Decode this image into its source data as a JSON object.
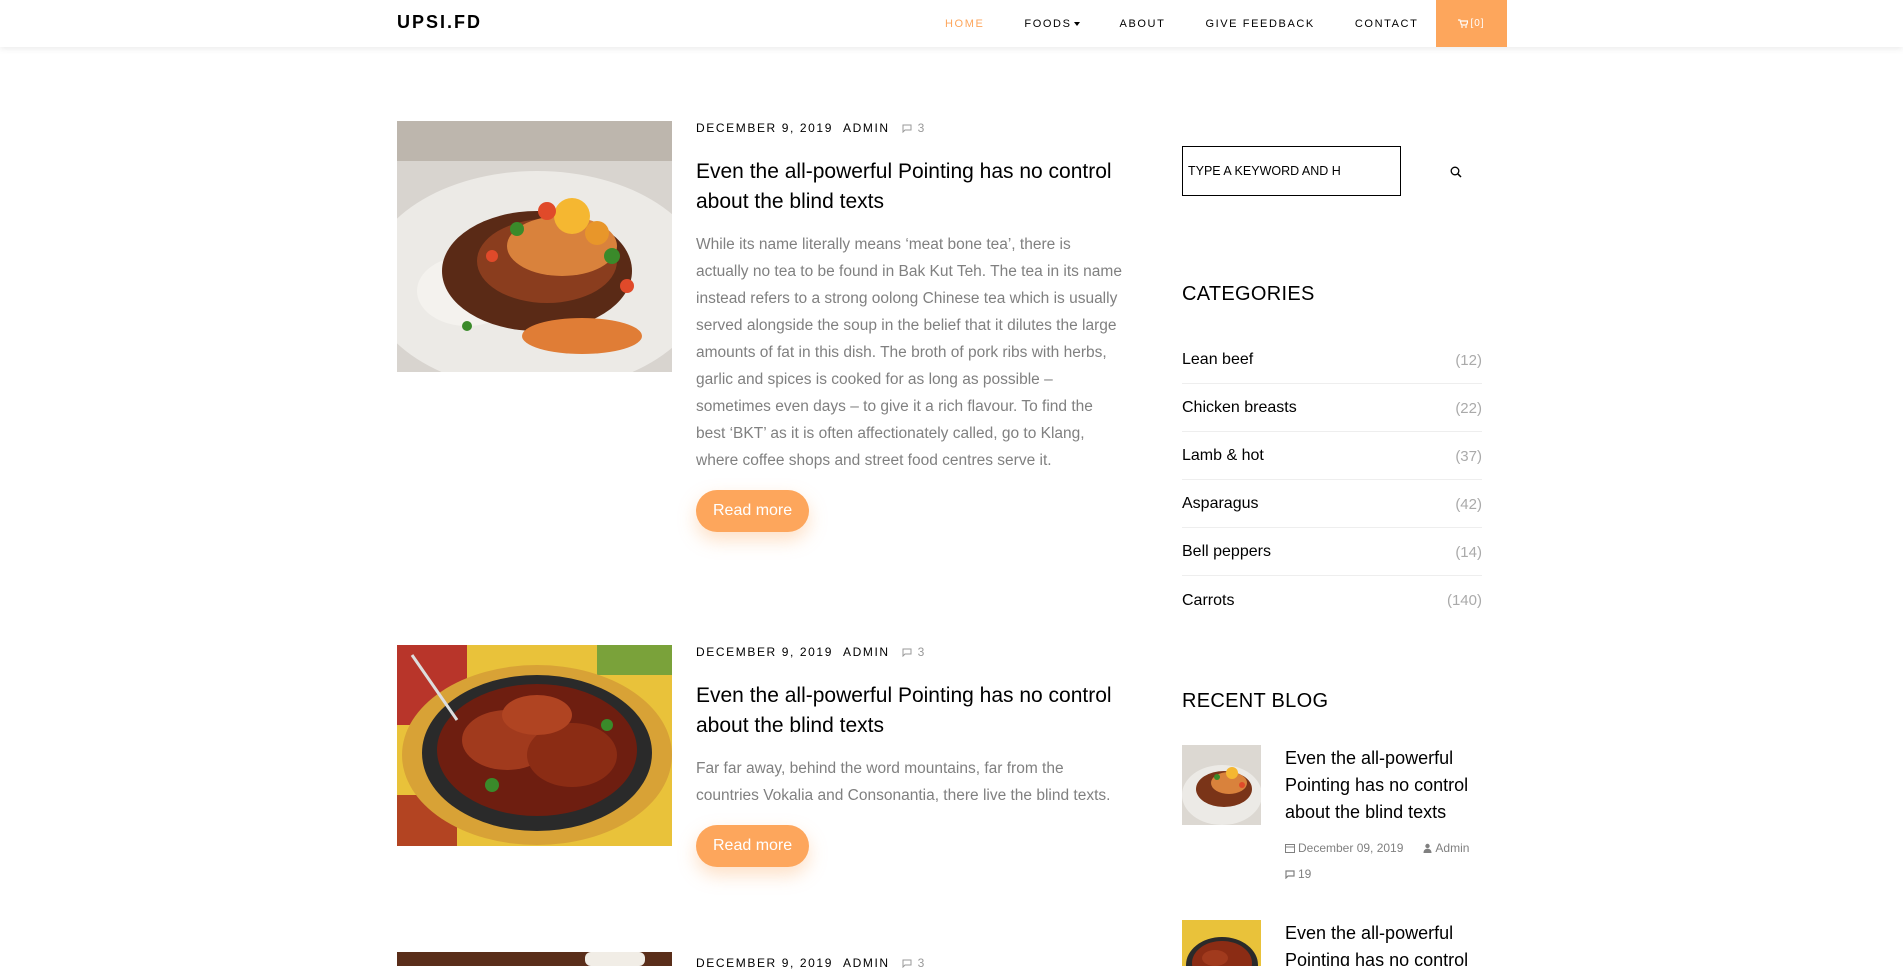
{
  "nav": {
    "brand": "UPSI.FD",
    "items": [
      {
        "label": "HOME",
        "active": true
      },
      {
        "label": "FOODS",
        "dropdown": true
      },
      {
        "label": "ABOUT"
      },
      {
        "label": "GIVE FEEDBACK"
      },
      {
        "label": "CONTACT"
      }
    ],
    "cart_label": "[0]",
    "cart_icon": "cart-icon",
    "accent_color": "#fda65c"
  },
  "posts": [
    {
      "date": "DECEMBER 9, 2019",
      "author": "ADMIN",
      "comments": "3",
      "title": "Even the all-powerful Pointing has no control about the blind texts",
      "excerpt": "While its name literally means ‘meat bone tea’, there is actually no tea to be found in Bak Kut Teh. The tea in its name instead refers to a strong oolong Chinese tea which is usually served alongside the soup in the belief that it dilutes the large amounts of fat in this dish. The broth of pork ribs with herbs, garlic and spices is cooked for as long as possible – sometimes even days – to give it a rich flavour. To find the best ‘BKT’ as it is often affectionately called, go to Klang, where coffee shops and street food centres serve it.",
      "read_more": "Read more"
    },
    {
      "date": "DECEMBER 9, 2019",
      "author": "ADMIN",
      "comments": "3",
      "title": "Even the all-powerful Pointing has no control about the blind texts",
      "excerpt": "Far far away, behind the word mountains, far from the countries Vokalia and Consonantia, there live the blind texts.",
      "read_more": "Read more"
    },
    {
      "date": "DECEMBER 9, 2019",
      "author": "ADMIN",
      "comments": "3"
    }
  ],
  "sidebar": {
    "search_placeholder": "TYPE A KEYWORD AND H",
    "categories_heading": "CATEGORIES",
    "categories": [
      {
        "name": "Lean beef",
        "count": "(12)"
      },
      {
        "name": "Chicken breasts",
        "count": "(22)"
      },
      {
        "name": "Lamb & hot",
        "count": "(37)"
      },
      {
        "name": "Asparagus",
        "count": "(42)"
      },
      {
        "name": "Bell peppers",
        "count": "(14)"
      },
      {
        "name": "Carrots",
        "count": "(140)"
      }
    ],
    "recent_heading": "RECENT BLOG",
    "recent": [
      {
        "title": "Even the all-powerful Pointing has no control about the blind texts",
        "date": "December 09, 2019",
        "author": "Admin",
        "comments": "19"
      },
      {
        "title": "Even the all-powerful Pointing has no control about the blind texts"
      }
    ]
  }
}
